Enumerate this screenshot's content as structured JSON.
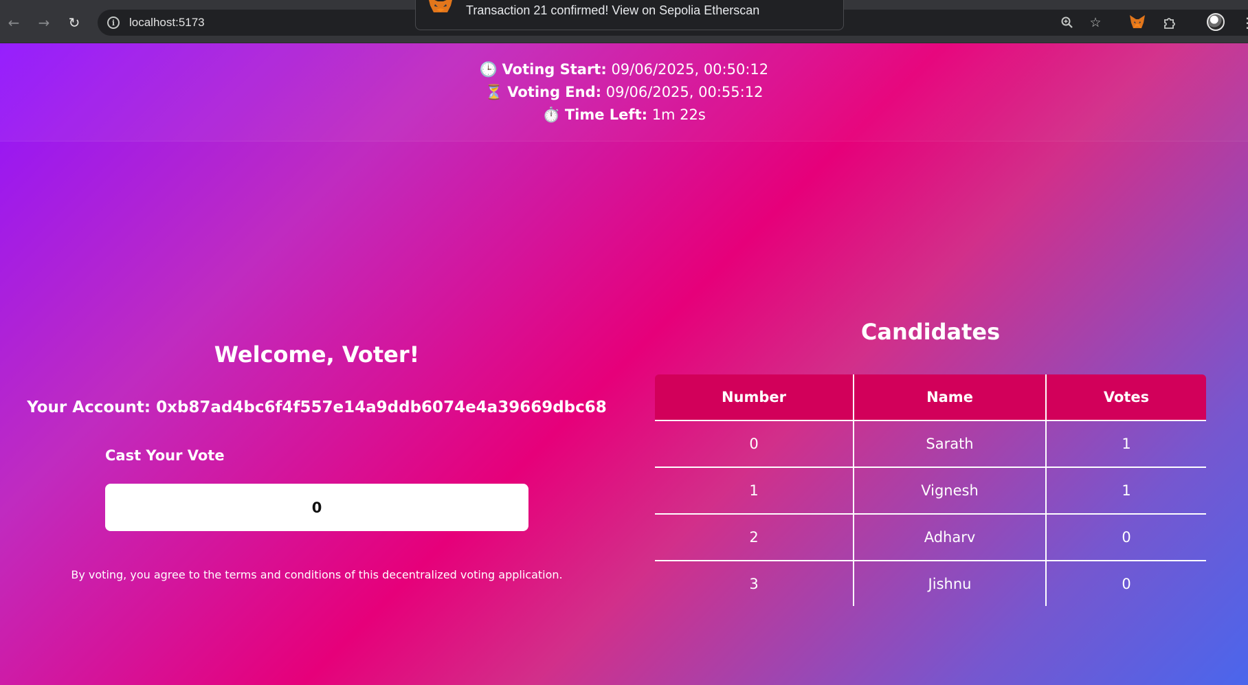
{
  "browser": {
    "url": "localhost:5173",
    "icons": {
      "back": "back-arrow-icon",
      "forward": "forward-arrow-icon",
      "reload": "reload-icon",
      "site_info": "info-icon",
      "zoom": "zoom-icon",
      "bookmark": "star-icon",
      "metamask": "metamask-fox-icon",
      "extensions": "puzzle-icon",
      "profile": "avatar",
      "menu": "kebab-menu-icon"
    }
  },
  "toast": {
    "message": "Transaction 21 confirmed! View on Sepolia Etherscan"
  },
  "timer": {
    "start_label": "Voting Start:",
    "start_value": "09/06/2025, 00:50:12",
    "end_label": "Voting End:",
    "end_value": "09/06/2025, 00:55:12",
    "left_label": "Time Left:",
    "left_value": "1m 22s",
    "start_emoji": "🕒",
    "end_emoji": "⏳",
    "left_emoji": "⏱️"
  },
  "voter": {
    "welcome": "Welcome, Voter!",
    "account_label": "Your Account:",
    "account": "0xb87ad4bc6f4f557e14a9ddb6074e4a39669dbc68",
    "cast_label": "Cast Your Vote",
    "vote_value": "0",
    "terms": "By voting, you agree to the terms and conditions of this decentralized voting application."
  },
  "candidates": {
    "title": "Candidates",
    "columns": [
      "Number",
      "Name",
      "Votes"
    ],
    "rows": [
      {
        "number": "0",
        "name": "Sarath",
        "votes": "1"
      },
      {
        "number": "1",
        "name": "Vignesh",
        "votes": "1"
      },
      {
        "number": "2",
        "name": "Adharv",
        "votes": "0"
      },
      {
        "number": "3",
        "name": "Jishnu",
        "votes": "0"
      }
    ]
  },
  "colors": {
    "gradient_start": "#9013fe",
    "gradient_mid": "#e6007a",
    "gradient_end": "#4a66ec",
    "table_header": "#d2005a"
  }
}
